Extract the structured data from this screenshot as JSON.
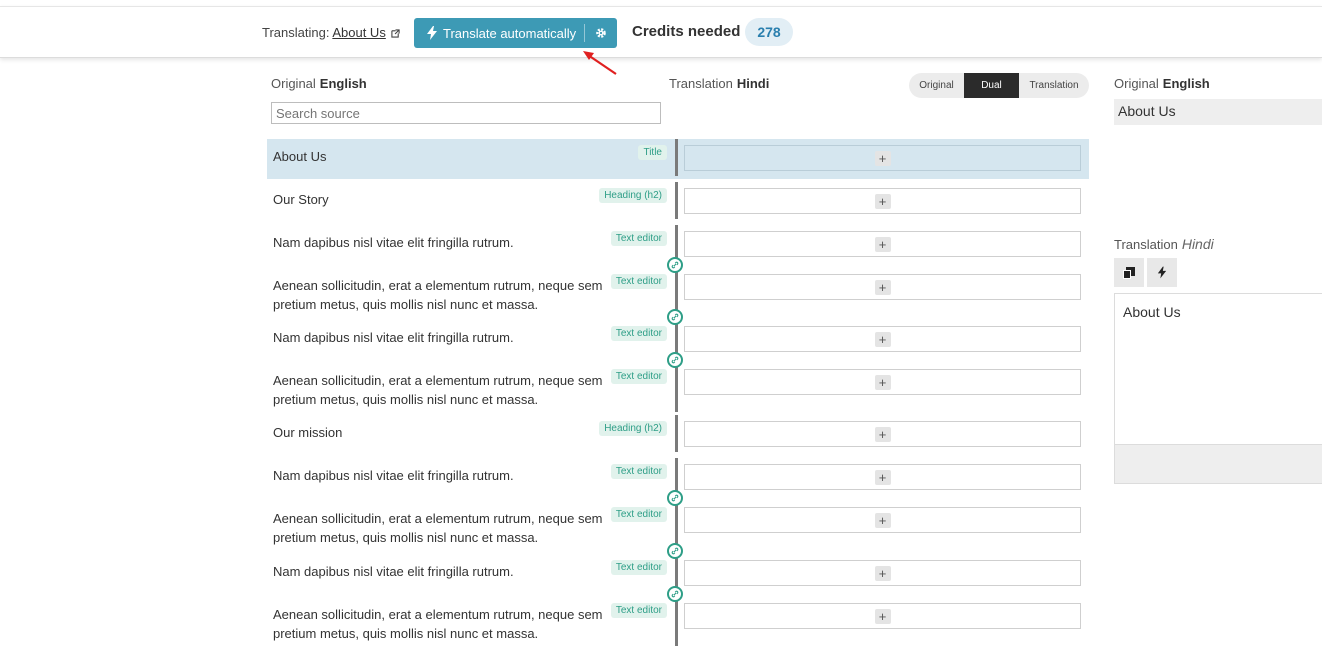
{
  "topbar": {
    "translating_label": "Translating:",
    "translating_page": "About Us",
    "translate_button": "Translate automatically",
    "credits_label": "Credits needed",
    "credits_value": "278"
  },
  "columns": {
    "original_label": "Original",
    "original_lang": "English",
    "translation_label": "Translation",
    "translation_lang": "Hindi",
    "search_placeholder": "Search source"
  },
  "view_toggle": {
    "options": [
      "Original",
      "Dual",
      "Translation"
    ],
    "active": "Dual"
  },
  "rows": [
    {
      "text": "About Us",
      "tag": "Title"
    },
    {
      "text": "Our Story",
      "tag": "Heading (h2)"
    },
    {
      "text": "Nam dapibus nisl vitae elit fringilla rutrum.",
      "tag": "Text editor"
    },
    {
      "text": "Aenean sollicitudin, erat a elementum rutrum, neque sem pretium metus, quis mollis nisl nunc et massa.",
      "tag": "Text editor"
    },
    {
      "text": "Nam dapibus nisl vitae elit fringilla rutrum.",
      "tag": "Text editor"
    },
    {
      "text": "Aenean sollicitudin, erat a elementum rutrum, neque sem pretium metus, quis mollis nisl nunc et massa.",
      "tag": "Text editor"
    },
    {
      "text": "Our mission",
      "tag": "Heading (h2)"
    },
    {
      "text": "Nam dapibus nisl vitae elit fringilla rutrum.",
      "tag": "Text editor"
    },
    {
      "text": "Aenean sollicitudin, erat a elementum rutrum, neque sem pretium metus, quis mollis nisl nunc et massa.",
      "tag": "Text editor"
    },
    {
      "text": "Nam dapibus nisl vitae elit fringilla rutrum.",
      "tag": "Text editor"
    },
    {
      "text": "Aenean sollicitudin, erat a elementum rutrum, neque sem pretium metus, quis mollis nisl nunc et massa.",
      "tag": "Text editor"
    }
  ],
  "right_panel": {
    "original_label": "Original",
    "original_lang": "English",
    "source_text": "About Us",
    "translation_label": "Translation",
    "translation_lang": "Hindi",
    "translation_text": "About Us",
    "buttons": [
      "copy-icon",
      "bolt-icon"
    ]
  },
  "colors": {
    "accent": "#3d9ab5",
    "tag_green": "#2e9e87",
    "selected_row": "#d5e6ef"
  }
}
